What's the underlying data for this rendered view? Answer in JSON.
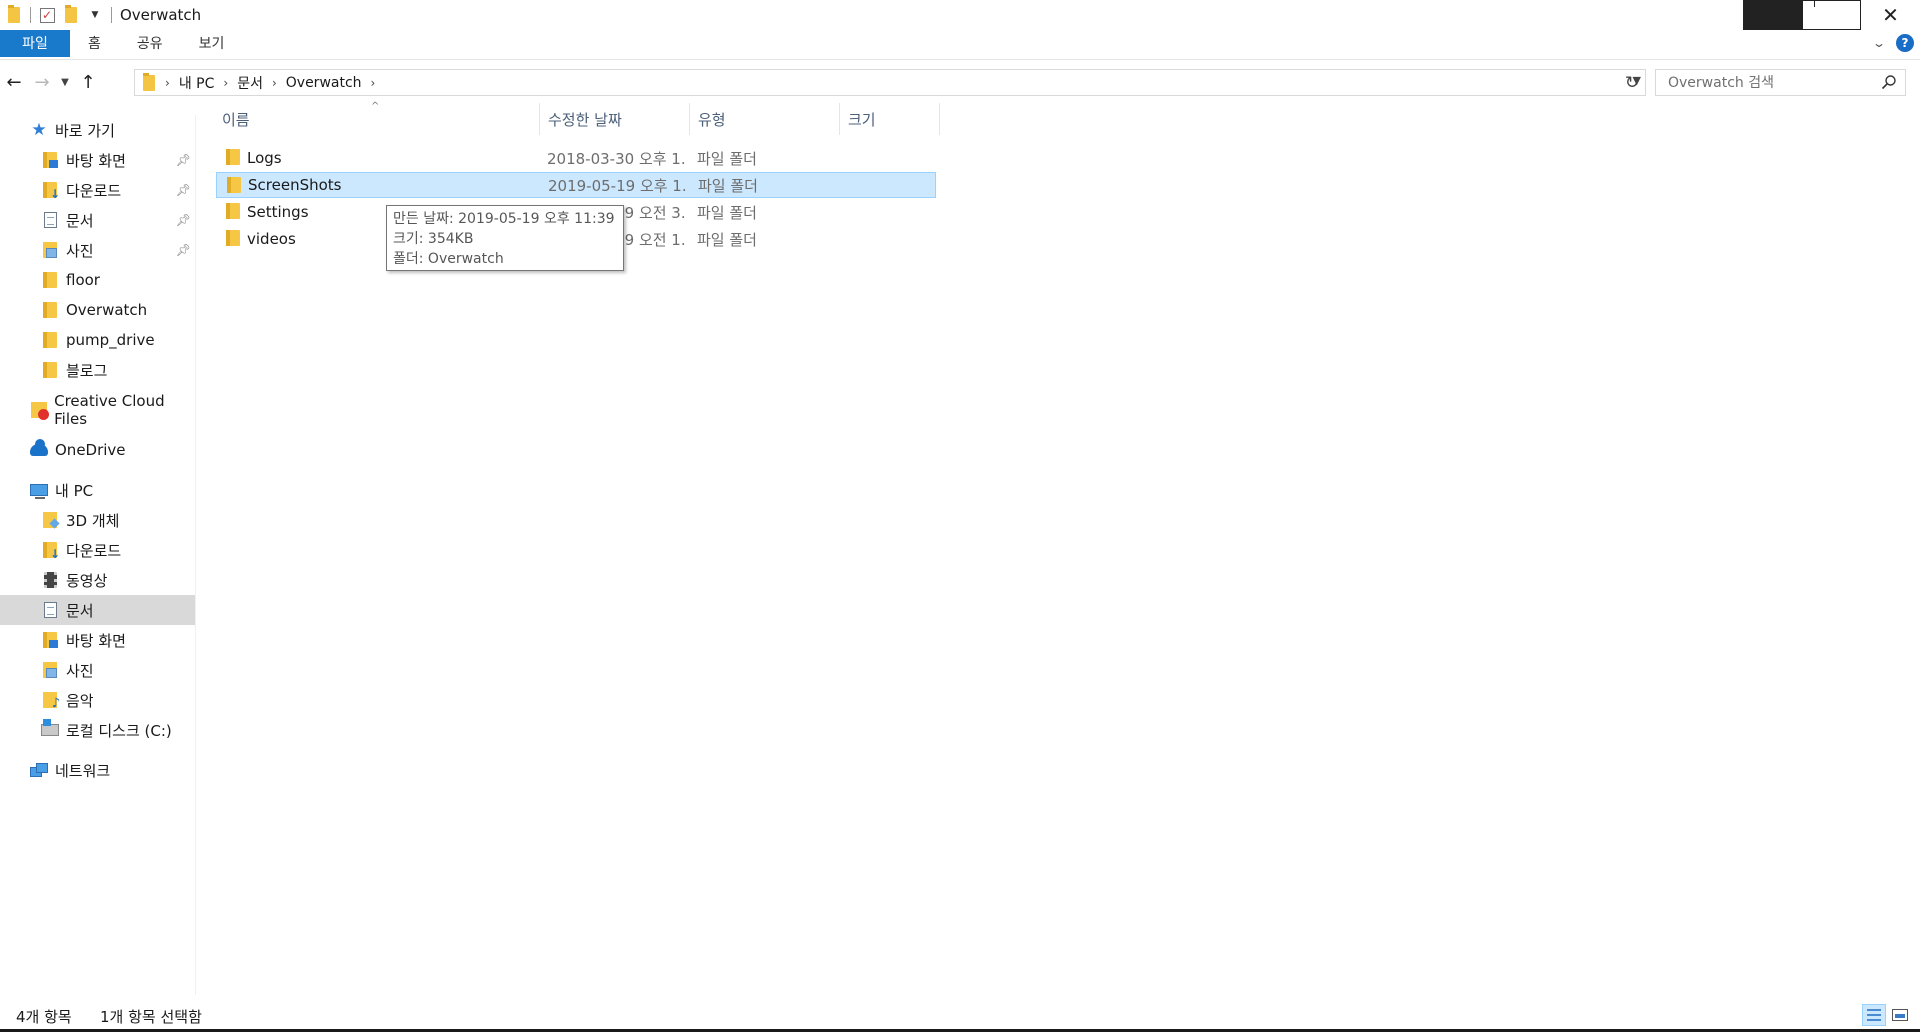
{
  "window": {
    "title": "Overwatch"
  },
  "ribbon": {
    "tabs": [
      "파일",
      "홈",
      "공유",
      "보기"
    ],
    "help": "?"
  },
  "address": {
    "crumbs": [
      "내 PC",
      "문서",
      "Overwatch"
    ],
    "search_placeholder": "Overwatch 검색"
  },
  "sidebar": {
    "quick_access": "바로 가기",
    "quick_items": [
      {
        "label": "바탕 화면",
        "icon": "desktop-folder-icon",
        "pinned": true
      },
      {
        "label": "다운로드",
        "icon": "downloads-folder-icon",
        "pinned": true
      },
      {
        "label": "문서",
        "icon": "documents-folder-icon",
        "pinned": true
      },
      {
        "label": "사진",
        "icon": "pictures-folder-icon",
        "pinned": true
      },
      {
        "label": "floor",
        "icon": "folder-icon",
        "pinned": false
      },
      {
        "label": "Overwatch",
        "icon": "folder-icon",
        "pinned": false
      },
      {
        "label": "pump_drive",
        "icon": "folder-icon",
        "pinned": false
      },
      {
        "label": "블로그",
        "icon": "folder-icon",
        "pinned": false
      }
    ],
    "creative_cloud": "Creative Cloud Files",
    "onedrive": "OneDrive",
    "this_pc": "내 PC",
    "pc_items": [
      {
        "label": "3D 개체",
        "icon": "3d-objects-icon"
      },
      {
        "label": "다운로드",
        "icon": "downloads-folder-icon"
      },
      {
        "label": "동영상",
        "icon": "videos-folder-icon"
      },
      {
        "label": "문서",
        "icon": "documents-folder-icon",
        "selected": true
      },
      {
        "label": "바탕 화면",
        "icon": "desktop-folder-icon"
      },
      {
        "label": "사진",
        "icon": "pictures-folder-icon"
      },
      {
        "label": "음악",
        "icon": "music-folder-icon"
      },
      {
        "label": "로컬 디스크 (C:)",
        "icon": "local-disk-icon"
      }
    ],
    "network": "네트워크"
  },
  "columns": {
    "name": "이름",
    "date": "수정한 날짜",
    "type": "유형",
    "size": "크기"
  },
  "files": [
    {
      "name": "Logs",
      "date": "2018-03-30 오후 1...",
      "type": "파일 폴더",
      "selected": false
    },
    {
      "name": "ScreenShots",
      "date": "2019-05-19 오후 1...",
      "type": "파일 폴더",
      "selected": true
    },
    {
      "name": "Settings",
      "date": "2019-05-19 오전 3...",
      "type": "파일 폴더",
      "selected": false
    },
    {
      "name": "videos",
      "date": "2019-05-19 오전 1...",
      "type": "파일 폴더",
      "selected": false
    }
  ],
  "tooltip": {
    "created": "만든 날짜: 2019-05-19 오후 11:39",
    "size": "크기: 354KB",
    "folder": "폴더: Overwatch"
  },
  "status": {
    "item_count": "4개 항목",
    "selected": "1개 항목 선택함"
  },
  "colors": {
    "accent": "#1979ca",
    "selection": "#cce8ff",
    "selection_border": "#99d1ff",
    "folder": "#f6c744"
  }
}
